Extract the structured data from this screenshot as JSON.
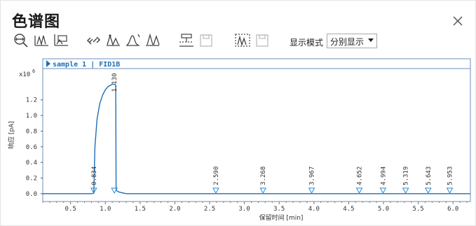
{
  "window": {
    "title": "色谱图"
  },
  "toolbar": {
    "icons": [
      "zoom-fit-icon",
      "peak-zoom-icon",
      "peak-compare-icon",
      "link-icon",
      "integrate-icon",
      "baseline-icon",
      "peak-shape-icon",
      "overlay-icon",
      "save-disabled-icon",
      "stack-icon",
      "save-disabled-2-icon"
    ],
    "mode_label": "显示模式",
    "mode_value": "分别显示"
  },
  "chart_data": {
    "type": "line",
    "title": "sample 1 | FID1B",
    "xlabel": "保留时间 [min]",
    "ylabel": "响应 [pA]",
    "yscale_label": "x10",
    "yscale_exp": "6",
    "xlim": [
      0.1,
      6.25
    ],
    "ylim": [
      -0.1,
      1.6
    ],
    "xticks": [
      "0.5",
      "1.0",
      "1.5",
      "2.0",
      "2.5",
      "3.0",
      "3.5",
      "4.0",
      "4.5",
      "5.0",
      "5.5",
      "6.0"
    ],
    "yticks": [
      "0.0",
      "0.2",
      "0.4",
      "0.6",
      "0.8",
      "1.0",
      "1.2"
    ],
    "series": [
      {
        "x": [
          0.1,
          0.6,
          0.8,
          0.834,
          0.85,
          0.88,
          0.92,
          0.96,
          1.0,
          1.04,
          1.08,
          1.1,
          1.12,
          1.14,
          1.15,
          1.155,
          1.16,
          1.2,
          1.3,
          2.0,
          3.0,
          4.0,
          5.0,
          6.0,
          6.25
        ],
        "y": [
          0.0,
          0.0,
          0.0,
          0.005,
          0.6,
          0.95,
          1.15,
          1.26,
          1.33,
          1.37,
          1.39,
          1.4,
          1.4,
          1.4,
          1.38,
          0.05,
          0.04,
          0.02,
          0.0,
          0.0,
          0.0,
          0.0,
          0.0,
          0.0,
          0.0
        ],
        "color": "#1f6fb4"
      }
    ],
    "peak_labels": [
      {
        "x": 0.834,
        "label": "0.834"
      },
      {
        "x": 1.13,
        "label": "1.130"
      },
      {
        "x": 2.59,
        "label": "2.590"
      },
      {
        "x": 3.268,
        "label": "3.268"
      },
      {
        "x": 3.967,
        "label": "3.967"
      },
      {
        "x": 4.652,
        "label": "4.652"
      },
      {
        "x": 4.994,
        "label": "4.994"
      },
      {
        "x": 5.319,
        "label": "5.319"
      },
      {
        "x": 5.643,
        "label": "5.643"
      },
      {
        "x": 5.953,
        "label": "5.953"
      }
    ],
    "grid": false
  },
  "colors": {
    "line": "#1f6fb4",
    "marker": "#2a8bd0",
    "header_text": "#1f6fb4"
  }
}
